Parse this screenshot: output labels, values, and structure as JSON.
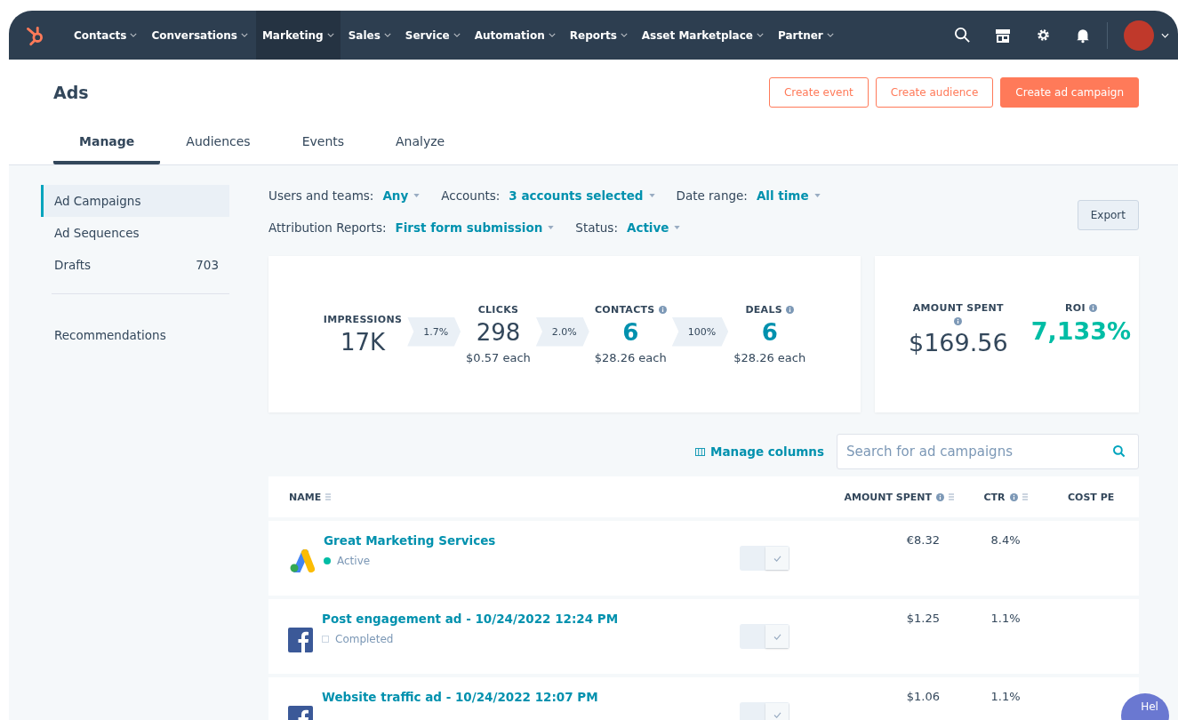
{
  "nav": {
    "items": [
      {
        "label": "Contacts",
        "selected": false
      },
      {
        "label": "Conversations",
        "selected": false
      },
      {
        "label": "Marketing",
        "selected": true
      },
      {
        "label": "Sales",
        "selected": false
      },
      {
        "label": "Service",
        "selected": false
      },
      {
        "label": "Automation",
        "selected": false
      },
      {
        "label": "Reports",
        "selected": false
      },
      {
        "label": "Asset Marketplace",
        "selected": false
      },
      {
        "label": "Partner",
        "selected": false
      }
    ]
  },
  "page": {
    "title": "Ads",
    "buttons": [
      {
        "label": "Create event",
        "kind": "secondary"
      },
      {
        "label": "Create audience",
        "kind": "secondary"
      },
      {
        "label": "Create ad campaign",
        "kind": "primary"
      }
    ]
  },
  "tabs": [
    {
      "label": "Manage",
      "selected": true
    },
    {
      "label": "Audiences",
      "selected": false
    },
    {
      "label": "Events",
      "selected": false
    },
    {
      "label": "Analyze",
      "selected": false
    }
  ],
  "sidebar": {
    "items": [
      {
        "label": "Ad Campaigns",
        "selected": true
      },
      {
        "label": "Ad Sequences",
        "selected": false
      },
      {
        "label": "Drafts",
        "count": "703",
        "selected": false
      }
    ],
    "footer_items": [
      {
        "label": "Recommendations",
        "selected": false
      }
    ]
  },
  "filters": [
    [
      {
        "label": "Users and teams:",
        "value": "Any"
      },
      {
        "label": "Accounts:",
        "value": "3 accounts selected"
      },
      {
        "label": "Date range:",
        "value": "All time"
      }
    ],
    [
      {
        "label": "Attribution Reports:",
        "value": "First form submission"
      },
      {
        "label": "Status:",
        "value": "Active"
      }
    ]
  ],
  "export_button": "Export",
  "funnel": [
    {
      "label": "IMPRESSIONS",
      "info": false,
      "value": "17K",
      "highlight": false
    },
    {
      "rate": "1.7%"
    },
    {
      "label": "CLICKS",
      "info": false,
      "value": "298",
      "highlight": false,
      "sub": "$0.57 each"
    },
    {
      "rate": "2.0%"
    },
    {
      "label": "CONTACTS",
      "info": true,
      "value": "6",
      "highlight": true,
      "sub": "$28.26 each"
    },
    {
      "rate": "100%"
    },
    {
      "label": "DEALS",
      "info": true,
      "value": "6",
      "highlight": true,
      "sub": "$28.26 each"
    }
  ],
  "summary": [
    {
      "label": "AMOUNT SPENT",
      "info": true,
      "value": "$169.56",
      "highlight": false
    },
    {
      "label": "ROI",
      "info": true,
      "value": "7,133%",
      "highlight": true
    }
  ],
  "manage_columns": "Manage columns",
  "search": {
    "placeholder": "Search for ad campaigns"
  },
  "table": {
    "columns": [
      {
        "label": "NAME",
        "info": false,
        "sortable": true
      },
      {
        "label": "AMOUNT SPENT",
        "info": true,
        "sortable": true
      },
      {
        "label": "CTR",
        "info": true,
        "sortable": true
      },
      {
        "label": "COST PE",
        "info": false,
        "sortable": false
      }
    ],
    "rows": [
      {
        "name": "Great Marketing Services",
        "kind": "google",
        "status": {
          "label": "Active",
          "kind": "active"
        },
        "on": true,
        "amount": "€8.32",
        "ctr": "8.4%"
      },
      {
        "name": "Post engagement ad - 10/24/2022 12:24 PM",
        "kind": "facebook",
        "status": {
          "label": "Completed",
          "kind": "completed"
        },
        "on": true,
        "amount": "$1.25",
        "ctr": "1.1%"
      },
      {
        "name": "Website traffic ad - 10/24/2022 12:07 PM",
        "kind": "facebook",
        "on": true,
        "amount": "$1.06",
        "ctr": "1.1%"
      }
    ]
  },
  "help_button": "Hel"
}
